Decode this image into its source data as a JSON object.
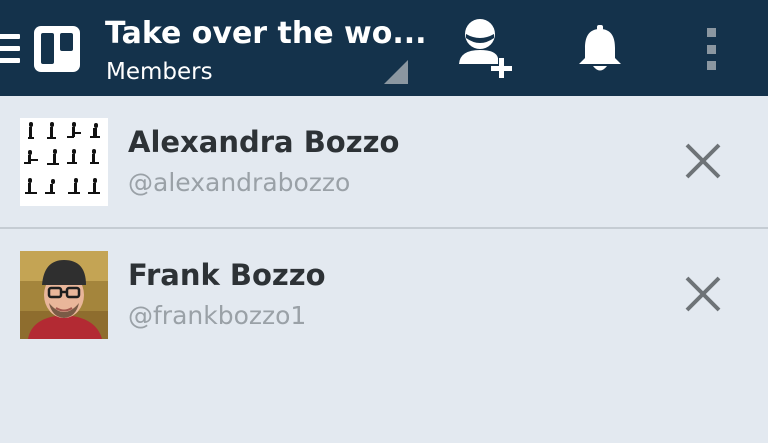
{
  "header": {
    "title": "Take over the wo...",
    "subtitle": "Members",
    "icons": {
      "menu": "hamburger-icon",
      "logo": "trello-board-icon",
      "add_member": "add-member-icon",
      "notifications": "bell-icon",
      "overflow": "more-vertical-icon"
    },
    "colors": {
      "bar": "#14324b",
      "icon": "#ffffff"
    }
  },
  "members": [
    {
      "name": "Alexandra Bozzo",
      "handle": "@alexandrabozzo",
      "avatar": "silhouette-grid-avatar",
      "remove_icon": "close-icon"
    },
    {
      "name": "Frank Bozzo",
      "handle": "@frankbozzo1",
      "avatar": "photo-avatar",
      "remove_icon": "close-icon"
    }
  ],
  "colors": {
    "background": "#e3e9f0",
    "name_text": "#2d3236",
    "handle_text": "#9aa1a7",
    "divider": "#c5ccd3"
  }
}
